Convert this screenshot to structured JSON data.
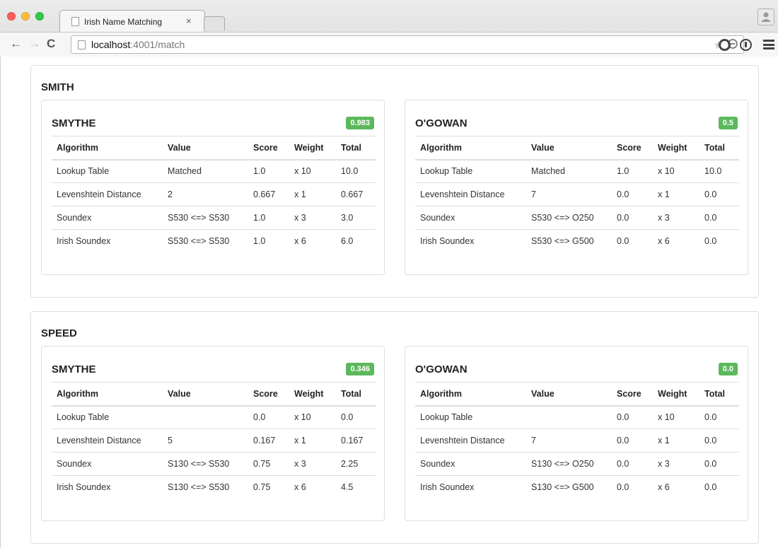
{
  "browser": {
    "tab_title": "Irish Name Matching",
    "tab_close": "×",
    "url_host": "localhost",
    "url_rest": ":4001/match",
    "star": "★"
  },
  "columns": [
    "Algorithm",
    "Value",
    "Score",
    "Weight",
    "Total"
  ],
  "groups": [
    {
      "name": "SMITH",
      "matches": [
        {
          "name": "SMYTHE",
          "score": "0.983",
          "rows": [
            [
              "Lookup Table",
              "Matched",
              "1.0",
              "x 10",
              "10.0"
            ],
            [
              "Levenshtein Distance",
              "2",
              "0.667",
              "x 1",
              "0.667"
            ],
            [
              "Soundex",
              "S530 <=> S530",
              "1.0",
              "x 3",
              "3.0"
            ],
            [
              "Irish Soundex",
              "S530 <=> S530",
              "1.0",
              "x 6",
              "6.0"
            ]
          ]
        },
        {
          "name": "O'GOWAN",
          "score": "0.5",
          "rows": [
            [
              "Lookup Table",
              "Matched",
              "1.0",
              "x 10",
              "10.0"
            ],
            [
              "Levenshtein Distance",
              "7",
              "0.0",
              "x 1",
              "0.0"
            ],
            [
              "Soundex",
              "S530 <=> O250",
              "0.0",
              "x 3",
              "0.0"
            ],
            [
              "Irish Soundex",
              "S530 <=> G500",
              "0.0",
              "x 6",
              "0.0"
            ]
          ]
        }
      ]
    },
    {
      "name": "SPEED",
      "matches": [
        {
          "name": "SMYTHE",
          "score": "0.346",
          "rows": [
            [
              "Lookup Table",
              "",
              "0.0",
              "x 10",
              "0.0"
            ],
            [
              "Levenshtein Distance",
              "5",
              "0.167",
              "x 1",
              "0.167"
            ],
            [
              "Soundex",
              "S130 <=> S530",
              "0.75",
              "x 3",
              "2.25"
            ],
            [
              "Irish Soundex",
              "S130 <=> S530",
              "0.75",
              "x 6",
              "4.5"
            ]
          ]
        },
        {
          "name": "O'GOWAN",
          "score": "0.0",
          "rows": [
            [
              "Lookup Table",
              "",
              "0.0",
              "x 10",
              "0.0"
            ],
            [
              "Levenshtein Distance",
              "7",
              "0.0",
              "x 1",
              "0.0"
            ],
            [
              "Soundex",
              "S130 <=> O250",
              "0.0",
              "x 3",
              "0.0"
            ],
            [
              "Irish Soundex",
              "S130 <=> G500",
              "0.0",
              "x 6",
              "0.0"
            ]
          ]
        }
      ]
    }
  ],
  "colors": {
    "badge": "#5cb85c",
    "border": "#dddddd"
  }
}
